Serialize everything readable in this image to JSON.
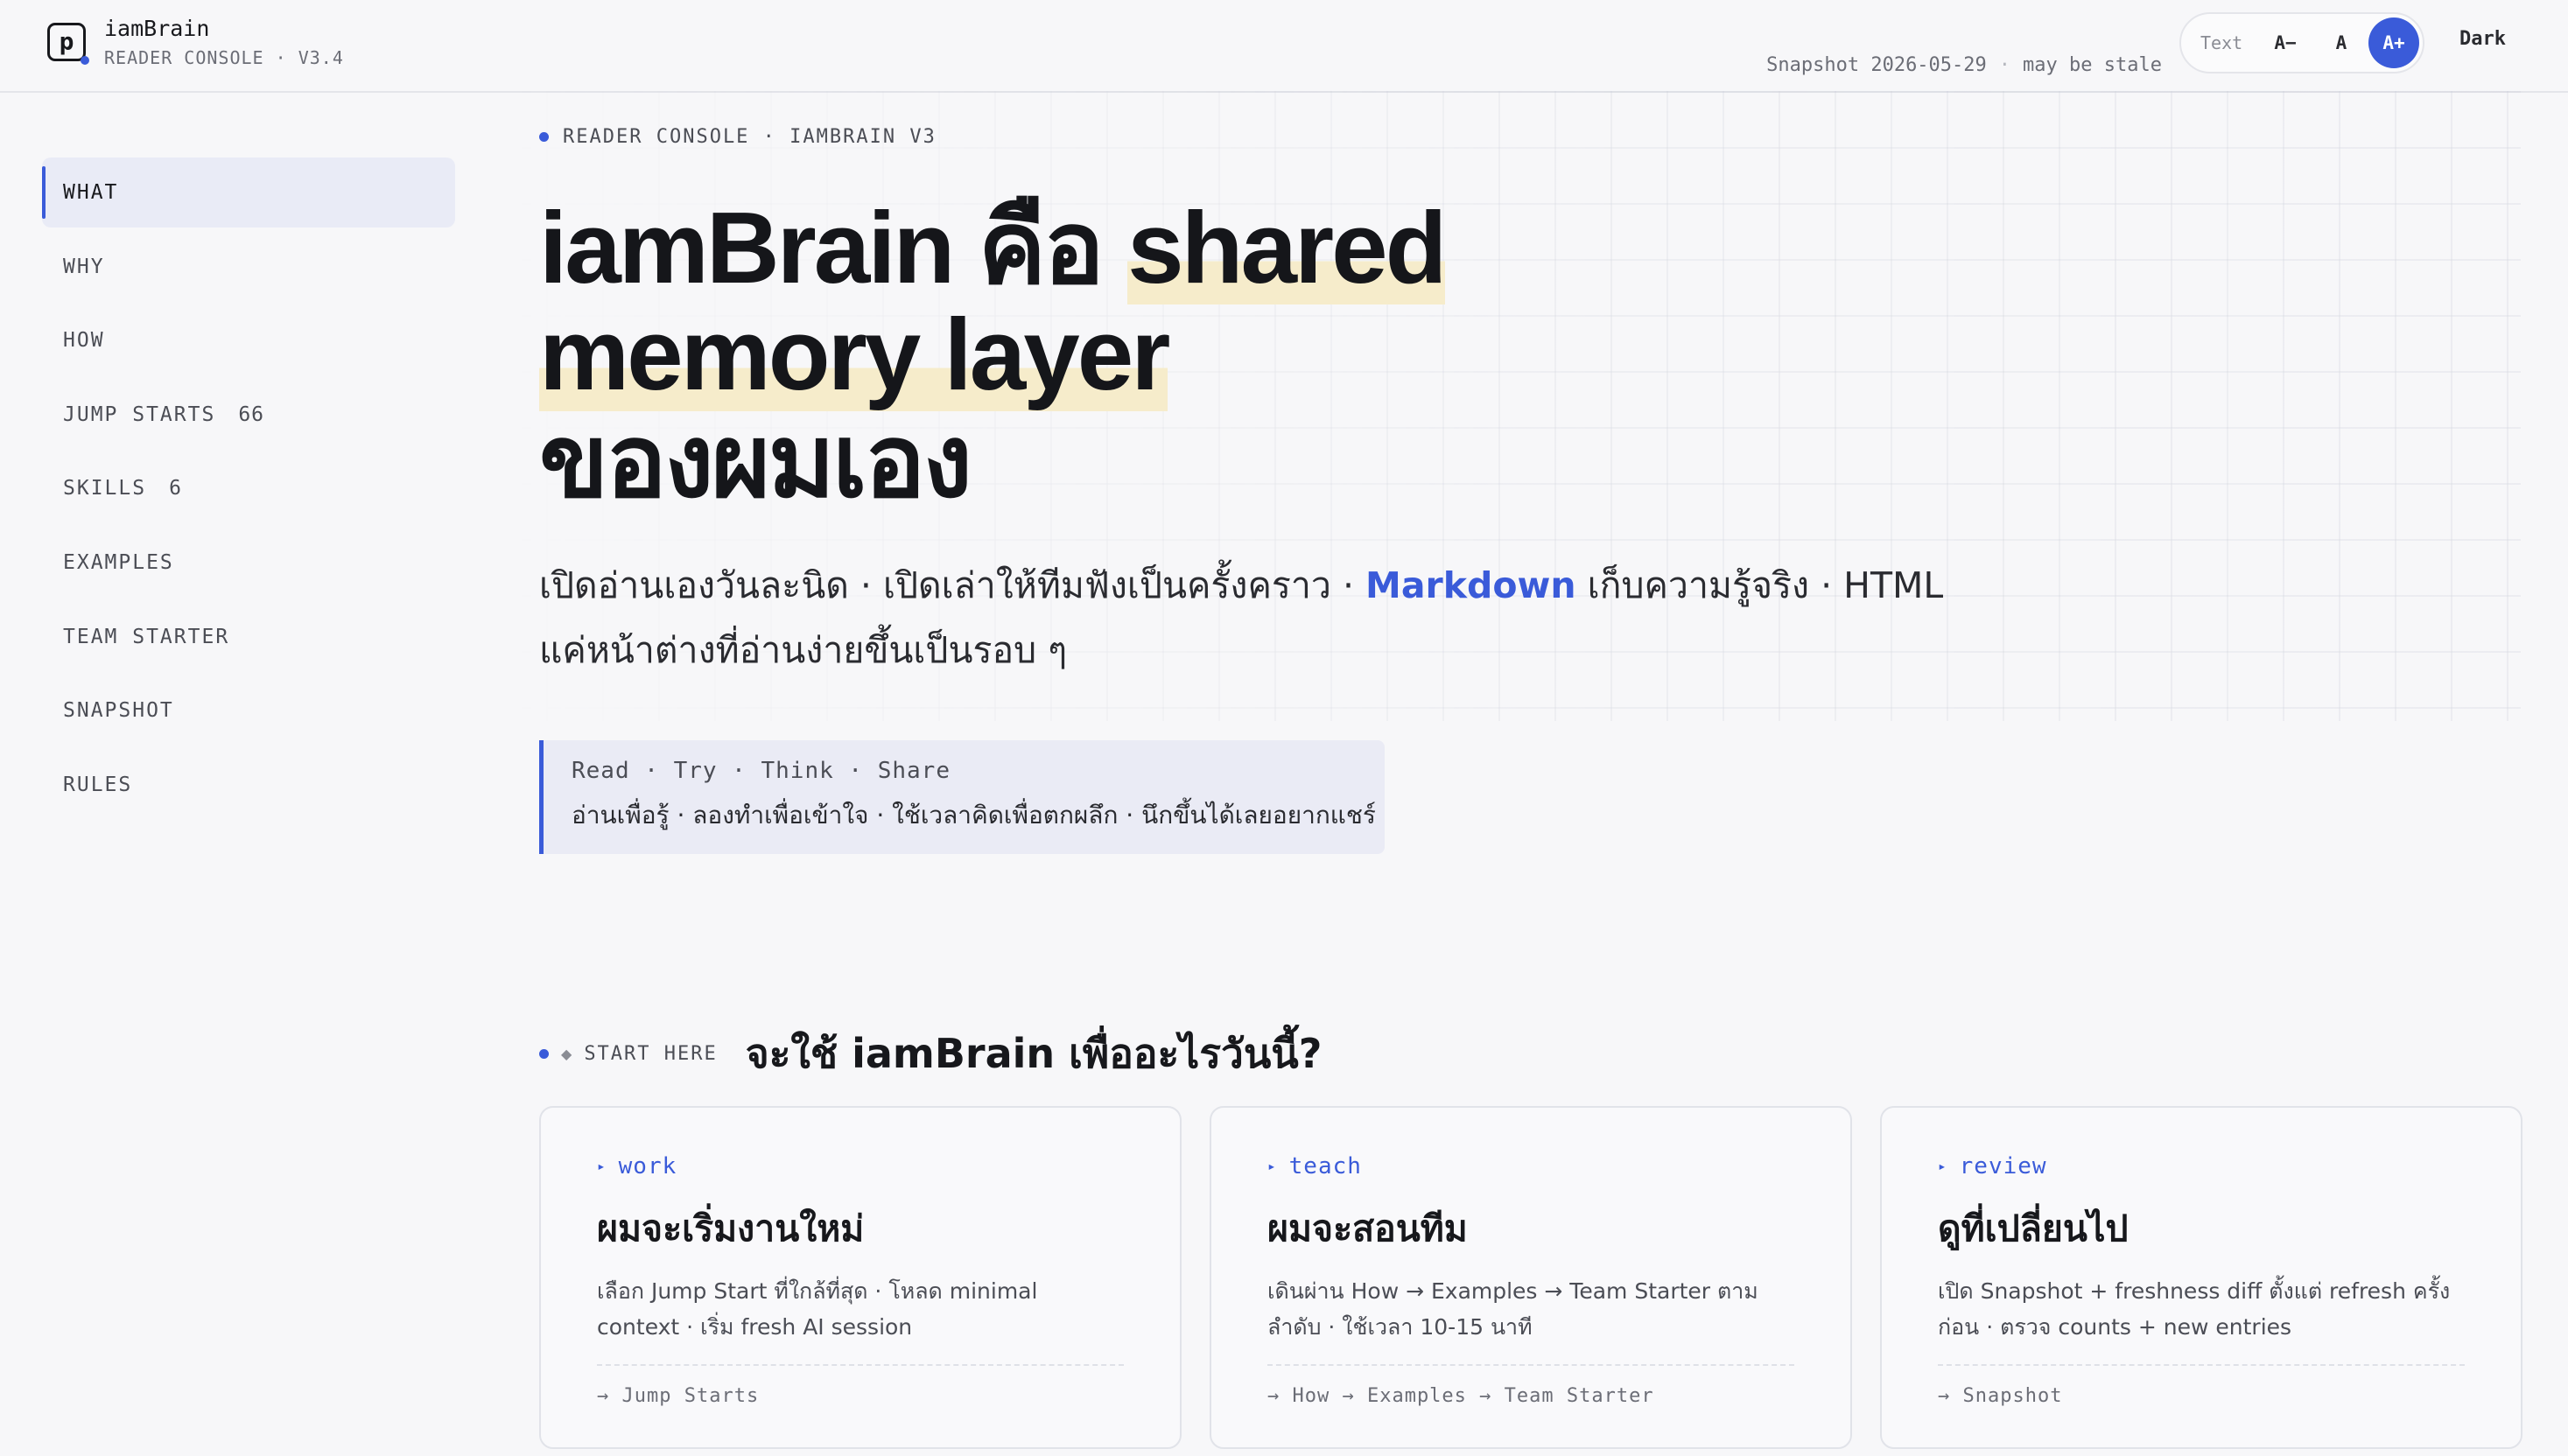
{
  "app": {
    "logo_letter": "p",
    "name": "iamBrain",
    "subtitle": "READER CONSOLE · V3.4"
  },
  "header": {
    "snapshot": "Snapshot 2026-05-29",
    "separator": "·",
    "stale_note": "may be stale",
    "text_label": "Text",
    "size_decrease": "A−",
    "size_default": "A",
    "size_increase": "A+",
    "dark_label": "Dark"
  },
  "sidebar": {
    "items": [
      {
        "label": "WHAT",
        "count": ""
      },
      {
        "label": "WHY",
        "count": ""
      },
      {
        "label": "HOW",
        "count": ""
      },
      {
        "label": "JUMP STARTS",
        "count": "66"
      },
      {
        "label": "SKILLS",
        "count": "6"
      },
      {
        "label": "EXAMPLES",
        "count": ""
      },
      {
        "label": "TEAM STARTER",
        "count": ""
      },
      {
        "label": "SNAPSHOT",
        "count": ""
      },
      {
        "label": "RULES",
        "count": ""
      }
    ]
  },
  "hero": {
    "kicker": "READER CONSOLE · IAMBRAIN V3",
    "title_part1": "iamBrain คือ ",
    "title_highlight1": "shared",
    "title_highlight2": "memory layer",
    "title_line3": "ของผมเอง",
    "sub_before": "เปิดอ่านเองวันละนิด · เปิดเล่าให้ทีมฟังเป็นครั้งคราว · ",
    "sub_accent": "Markdown",
    "sub_after": " เก็บความรู้จริง · HTML แค่หน้าต่างที่อ่านง่ายขึ้นเป็นรอบ ๆ"
  },
  "callout": {
    "line1": "Read · Try · Think · Share",
    "line2": "อ่านเพื่อรู้ · ลองทำเพื่อเข้าใจ · ใช้เวลาคิดเพื่อตกผลึก · นึกขึ้นได้เลยอยากแชร์"
  },
  "start": {
    "tag": "START HERE",
    "question": "จะใช้ iamBrain เพื่ออะไรวันนี้?",
    "cards": [
      {
        "tag": "work",
        "title": "ผมจะเริ่มงานใหม่",
        "desc": "เลือก Jump Start ที่ใกล้ที่สุด · โหลด minimal context · เริ่ม fresh AI session",
        "link": "→ Jump Starts"
      },
      {
        "tag": "teach",
        "title": "ผมจะสอนทีม",
        "desc": "เดินผ่าน How → Examples → Team Starter ตามลำดับ · ใช้เวลา 10-15 นาที",
        "link": "→ How → Examples → Team Starter"
      },
      {
        "tag": "review",
        "title": "ดูที่เปลี่ยนไป",
        "desc": "เปิด Snapshot + freshness diff ตั้งแต่ refresh ครั้งก่อน · ตรวจ counts + new entries",
        "link": "→ Snapshot"
      }
    ]
  },
  "colors": {
    "accent": "#3a5bd9",
    "highlight": "#f6eccb",
    "background": "#f7f7f9"
  },
  "icons": {
    "logo": "p-square-logo-icon",
    "card_marker": "triangle-right-icon",
    "bullet": "dot-icon"
  }
}
